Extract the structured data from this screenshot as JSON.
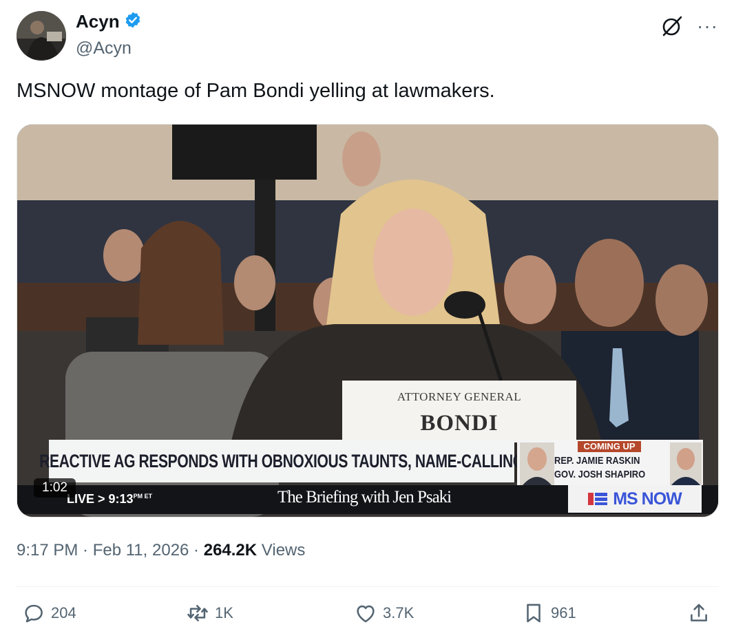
{
  "author": {
    "display_name": "Acyn",
    "handle": "@Acyn",
    "verified": true,
    "verified_color": "#1d9bf0"
  },
  "tweet": {
    "text": "MSNOW montage of Pam Bondi yelling at lawmakers."
  },
  "media": {
    "duration": "1:02",
    "nameplate_title": "ATTORNEY GENERAL",
    "nameplate_name": "BONDI",
    "chyron": "REACTIVE AG RESPONDS WITH OBNOXIOUS TAUNTS, NAME-CALLING",
    "coming_up_label": "COMING UP",
    "guest_1": "REP. JAMIE RASKIN",
    "guest_2": "GOV. JOSH SHAPIRO",
    "live_label": "LIVE",
    "time": "9:13",
    "time_zone": "PM ET",
    "show_title": "The Briefing with Jen Psaki",
    "network": "MS NOW"
  },
  "meta": {
    "time": "9:17 PM",
    "date": "Feb 11, 2026",
    "views_count": "264.2K",
    "views_label": "Views"
  },
  "actions": {
    "replies": "204",
    "reposts": "1K",
    "likes": "3.7K",
    "bookmarks": "961"
  },
  "icons": {
    "avatar": "avatar-photo",
    "verified": "verified-badge-icon",
    "grok": "grok-icon",
    "more": "more-icon",
    "reply": "reply-icon",
    "repost": "repost-icon",
    "like": "like-icon",
    "bookmark": "bookmark-icon",
    "share": "share-icon"
  }
}
